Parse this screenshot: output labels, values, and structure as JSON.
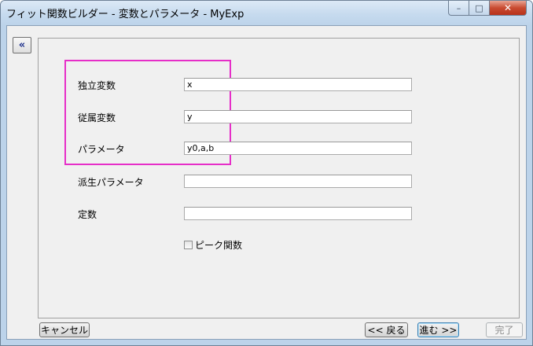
{
  "window": {
    "title": "フィット関数ビルダー - 変数とパラメータ - MyExp",
    "controls": {
      "minimize": "–",
      "maximize": "□",
      "close": "✕"
    }
  },
  "collapse_button": {
    "label": "«"
  },
  "form": {
    "rows": [
      {
        "label": "独立変数",
        "value": "x"
      },
      {
        "label": "従属変数",
        "value": "y"
      },
      {
        "label": "パラメータ",
        "value": "y0,a,b"
      },
      {
        "label": "派生パラメータ",
        "value": ""
      },
      {
        "label": "定数",
        "value": ""
      }
    ],
    "peak_checkbox": {
      "label": "ピーク関数",
      "checked": false
    }
  },
  "footer": {
    "cancel": "キャンセル",
    "back": "<< 戻る",
    "next": "進む >>",
    "finish": "完了"
  },
  "colors": {
    "highlight": "#e62ec8",
    "titlebar": "#c6daee",
    "close_button": "#c94b31"
  }
}
